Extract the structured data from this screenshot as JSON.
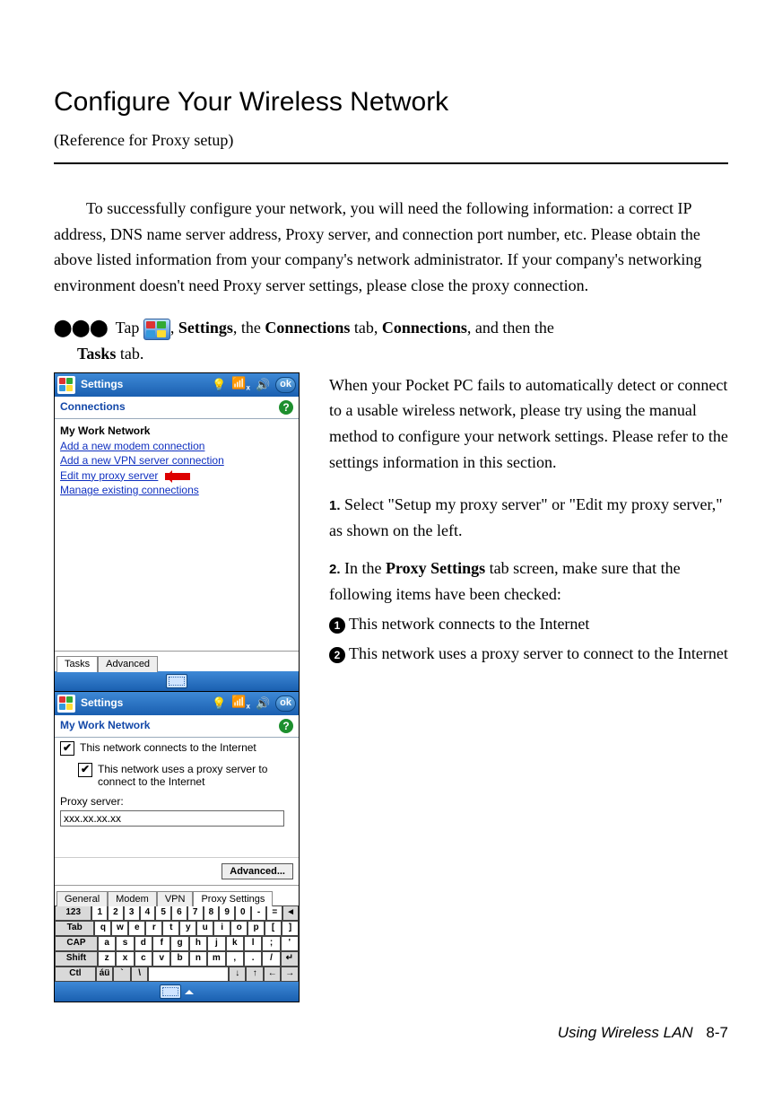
{
  "heading": "Configure Your Wireless Network",
  "subtitle": "(Reference for Proxy setup)",
  "intro": "To successfully configure your network, you will need the following information: a correct IP address, DNS name server address, Proxy server, and connection port number, etc. Please obtain the above listed information from your company's network administrator. If your company's networking environment doesn't need Proxy server settings, please close the proxy connection.",
  "first_step": {
    "prefix": "Tap ",
    "after_icon_1": ", ",
    "b1": "Settings",
    "mid1": ", the ",
    "b2": "Connections",
    "mid2": " tab, ",
    "b3": "Connections",
    "mid3": ", and then the ",
    "b4": "Tasks",
    "mid4": " tab."
  },
  "pda1": {
    "title": "Settings",
    "ok": "ok",
    "subheader": "Connections",
    "section": "My Work Network",
    "links": {
      "modem": "Add a new modem connection",
      "vpn": "Add a new VPN server connection",
      "proxy": "Edit my proxy server",
      "manage": "Manage existing connections"
    },
    "tabs": {
      "tasks": "Tasks",
      "advanced": "Advanced"
    }
  },
  "pda2": {
    "title": "Settings",
    "ok": "ok",
    "subheader": "My Work Network",
    "chk1": "This network connects to the Internet",
    "chk2": "This network uses a proxy server to connect to the Internet",
    "proxy_label": "Proxy server:",
    "proxy_value": "xxx.xx.xx.xx",
    "advanced": "Advanced...",
    "tabs": {
      "general": "General",
      "modem": "Modem",
      "vpn": "VPN",
      "proxy": "Proxy Settings"
    }
  },
  "keyboard": {
    "r1": [
      "123",
      "1",
      "2",
      "3",
      "4",
      "5",
      "6",
      "7",
      "8",
      "9",
      "0",
      "-",
      "=",
      "◄"
    ],
    "r2": [
      "Tab",
      "q",
      "w",
      "e",
      "r",
      "t",
      "y",
      "u",
      "i",
      "o",
      "p",
      "[",
      "]"
    ],
    "r3": [
      "CAP",
      "a",
      "s",
      "d",
      "f",
      "g",
      "h",
      "j",
      "k",
      "l",
      ";",
      "'"
    ],
    "r4": [
      "Shift",
      "z",
      "x",
      "c",
      "v",
      "b",
      "n",
      "m",
      ",",
      ".",
      "/",
      "↵"
    ],
    "r5": [
      "Ctl",
      "áü",
      "`",
      "\\",
      " ",
      "↓",
      "↑",
      "←",
      "→"
    ]
  },
  "rightcol": {
    "para": "When your Pocket PC fails to automatically detect or connect to a usable wireless network, please try using the manual method to configure your network settings. Please refer to the settings information in this section.",
    "step1_num": "1.",
    "step1": "Select \"Setup my proxy server\" or \"Edit my proxy server,\" as shown on the left.",
    "step2_num": "2.",
    "step2_a": "In the ",
    "step2_b": "Proxy Settings",
    "step2_c": " tab screen, make sure that the following items have been checked:",
    "c1_num": "1",
    "c1": "This network connects to the Internet",
    "c2_num": "2",
    "c2": "This network uses a proxy server to connect to the Internet"
  },
  "footer": {
    "text": "Using Wireless LAN",
    "page": "8-7"
  }
}
